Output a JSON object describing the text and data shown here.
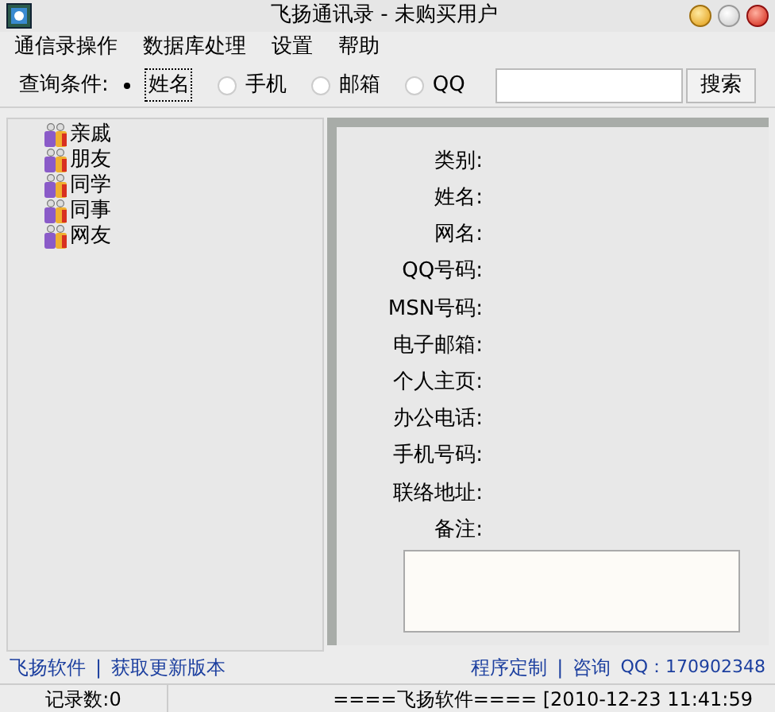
{
  "window": {
    "title": "飞扬通讯录 - 未购买用户"
  },
  "menu": [
    "通信录操作",
    "数据库处理",
    "设置",
    "帮助"
  ],
  "search": {
    "label": "查询条件:",
    "options": [
      {
        "label": "姓名",
        "selected": true
      },
      {
        "label": "手机",
        "selected": false
      },
      {
        "label": "邮箱",
        "selected": false
      },
      {
        "label": "QQ",
        "selected": false
      }
    ],
    "button": "搜索"
  },
  "tree": [
    {
      "label": "亲戚"
    },
    {
      "label": "朋友"
    },
    {
      "label": "同学"
    },
    {
      "label": "同事"
    },
    {
      "label": "网友"
    }
  ],
  "fields": [
    "类别:",
    "姓名:",
    "网名:",
    "QQ号码:",
    "MSN号码:",
    "电子邮箱:",
    "个人主页:",
    "办公电话:",
    "手机号码:",
    "联络地址:"
  ],
  "notes": {
    "label": "备注:"
  },
  "links_left": [
    "飞扬软件",
    "获取更新版本"
  ],
  "links_right": [
    "程序定制",
    "咨询",
    "QQ：170902348"
  ],
  "separator": "|",
  "status_bar": {
    "count": "记录数:0",
    "info": "====飞扬软件==== [2010-12-23 11:41:59"
  }
}
